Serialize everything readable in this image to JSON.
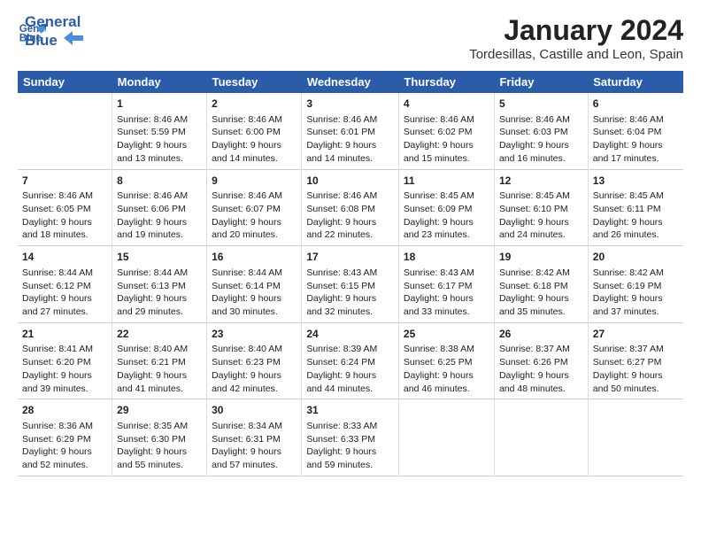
{
  "logo": {
    "text_general": "General",
    "text_blue": "Blue"
  },
  "title": "January 2024",
  "location": "Tordesillas, Castille and Leon, Spain",
  "weekdays": [
    "Sunday",
    "Monday",
    "Tuesday",
    "Wednesday",
    "Thursday",
    "Friday",
    "Saturday"
  ],
  "weeks": [
    [
      {
        "day": "",
        "info": ""
      },
      {
        "day": "1",
        "info": "Sunrise: 8:46 AM\nSunset: 5:59 PM\nDaylight: 9 hours\nand 13 minutes."
      },
      {
        "day": "2",
        "info": "Sunrise: 8:46 AM\nSunset: 6:00 PM\nDaylight: 9 hours\nand 14 minutes."
      },
      {
        "day": "3",
        "info": "Sunrise: 8:46 AM\nSunset: 6:01 PM\nDaylight: 9 hours\nand 14 minutes."
      },
      {
        "day": "4",
        "info": "Sunrise: 8:46 AM\nSunset: 6:02 PM\nDaylight: 9 hours\nand 15 minutes."
      },
      {
        "day": "5",
        "info": "Sunrise: 8:46 AM\nSunset: 6:03 PM\nDaylight: 9 hours\nand 16 minutes."
      },
      {
        "day": "6",
        "info": "Sunrise: 8:46 AM\nSunset: 6:04 PM\nDaylight: 9 hours\nand 17 minutes."
      }
    ],
    [
      {
        "day": "7",
        "info": "Sunrise: 8:46 AM\nSunset: 6:05 PM\nDaylight: 9 hours\nand 18 minutes."
      },
      {
        "day": "8",
        "info": "Sunrise: 8:46 AM\nSunset: 6:06 PM\nDaylight: 9 hours\nand 19 minutes."
      },
      {
        "day": "9",
        "info": "Sunrise: 8:46 AM\nSunset: 6:07 PM\nDaylight: 9 hours\nand 20 minutes."
      },
      {
        "day": "10",
        "info": "Sunrise: 8:46 AM\nSunset: 6:08 PM\nDaylight: 9 hours\nand 22 minutes."
      },
      {
        "day": "11",
        "info": "Sunrise: 8:45 AM\nSunset: 6:09 PM\nDaylight: 9 hours\nand 23 minutes."
      },
      {
        "day": "12",
        "info": "Sunrise: 8:45 AM\nSunset: 6:10 PM\nDaylight: 9 hours\nand 24 minutes."
      },
      {
        "day": "13",
        "info": "Sunrise: 8:45 AM\nSunset: 6:11 PM\nDaylight: 9 hours\nand 26 minutes."
      }
    ],
    [
      {
        "day": "14",
        "info": "Sunrise: 8:44 AM\nSunset: 6:12 PM\nDaylight: 9 hours\nand 27 minutes."
      },
      {
        "day": "15",
        "info": "Sunrise: 8:44 AM\nSunset: 6:13 PM\nDaylight: 9 hours\nand 29 minutes."
      },
      {
        "day": "16",
        "info": "Sunrise: 8:44 AM\nSunset: 6:14 PM\nDaylight: 9 hours\nand 30 minutes."
      },
      {
        "day": "17",
        "info": "Sunrise: 8:43 AM\nSunset: 6:15 PM\nDaylight: 9 hours\nand 32 minutes."
      },
      {
        "day": "18",
        "info": "Sunrise: 8:43 AM\nSunset: 6:17 PM\nDaylight: 9 hours\nand 33 minutes."
      },
      {
        "day": "19",
        "info": "Sunrise: 8:42 AM\nSunset: 6:18 PM\nDaylight: 9 hours\nand 35 minutes."
      },
      {
        "day": "20",
        "info": "Sunrise: 8:42 AM\nSunset: 6:19 PM\nDaylight: 9 hours\nand 37 minutes."
      }
    ],
    [
      {
        "day": "21",
        "info": "Sunrise: 8:41 AM\nSunset: 6:20 PM\nDaylight: 9 hours\nand 39 minutes."
      },
      {
        "day": "22",
        "info": "Sunrise: 8:40 AM\nSunset: 6:21 PM\nDaylight: 9 hours\nand 41 minutes."
      },
      {
        "day": "23",
        "info": "Sunrise: 8:40 AM\nSunset: 6:23 PM\nDaylight: 9 hours\nand 42 minutes."
      },
      {
        "day": "24",
        "info": "Sunrise: 8:39 AM\nSunset: 6:24 PM\nDaylight: 9 hours\nand 44 minutes."
      },
      {
        "day": "25",
        "info": "Sunrise: 8:38 AM\nSunset: 6:25 PM\nDaylight: 9 hours\nand 46 minutes."
      },
      {
        "day": "26",
        "info": "Sunrise: 8:37 AM\nSunset: 6:26 PM\nDaylight: 9 hours\nand 48 minutes."
      },
      {
        "day": "27",
        "info": "Sunrise: 8:37 AM\nSunset: 6:27 PM\nDaylight: 9 hours\nand 50 minutes."
      }
    ],
    [
      {
        "day": "28",
        "info": "Sunrise: 8:36 AM\nSunset: 6:29 PM\nDaylight: 9 hours\nand 52 minutes."
      },
      {
        "day": "29",
        "info": "Sunrise: 8:35 AM\nSunset: 6:30 PM\nDaylight: 9 hours\nand 55 minutes."
      },
      {
        "day": "30",
        "info": "Sunrise: 8:34 AM\nSunset: 6:31 PM\nDaylight: 9 hours\nand 57 minutes."
      },
      {
        "day": "31",
        "info": "Sunrise: 8:33 AM\nSunset: 6:33 PM\nDaylight: 9 hours\nand 59 minutes."
      },
      {
        "day": "",
        "info": ""
      },
      {
        "day": "",
        "info": ""
      },
      {
        "day": "",
        "info": ""
      }
    ]
  ]
}
